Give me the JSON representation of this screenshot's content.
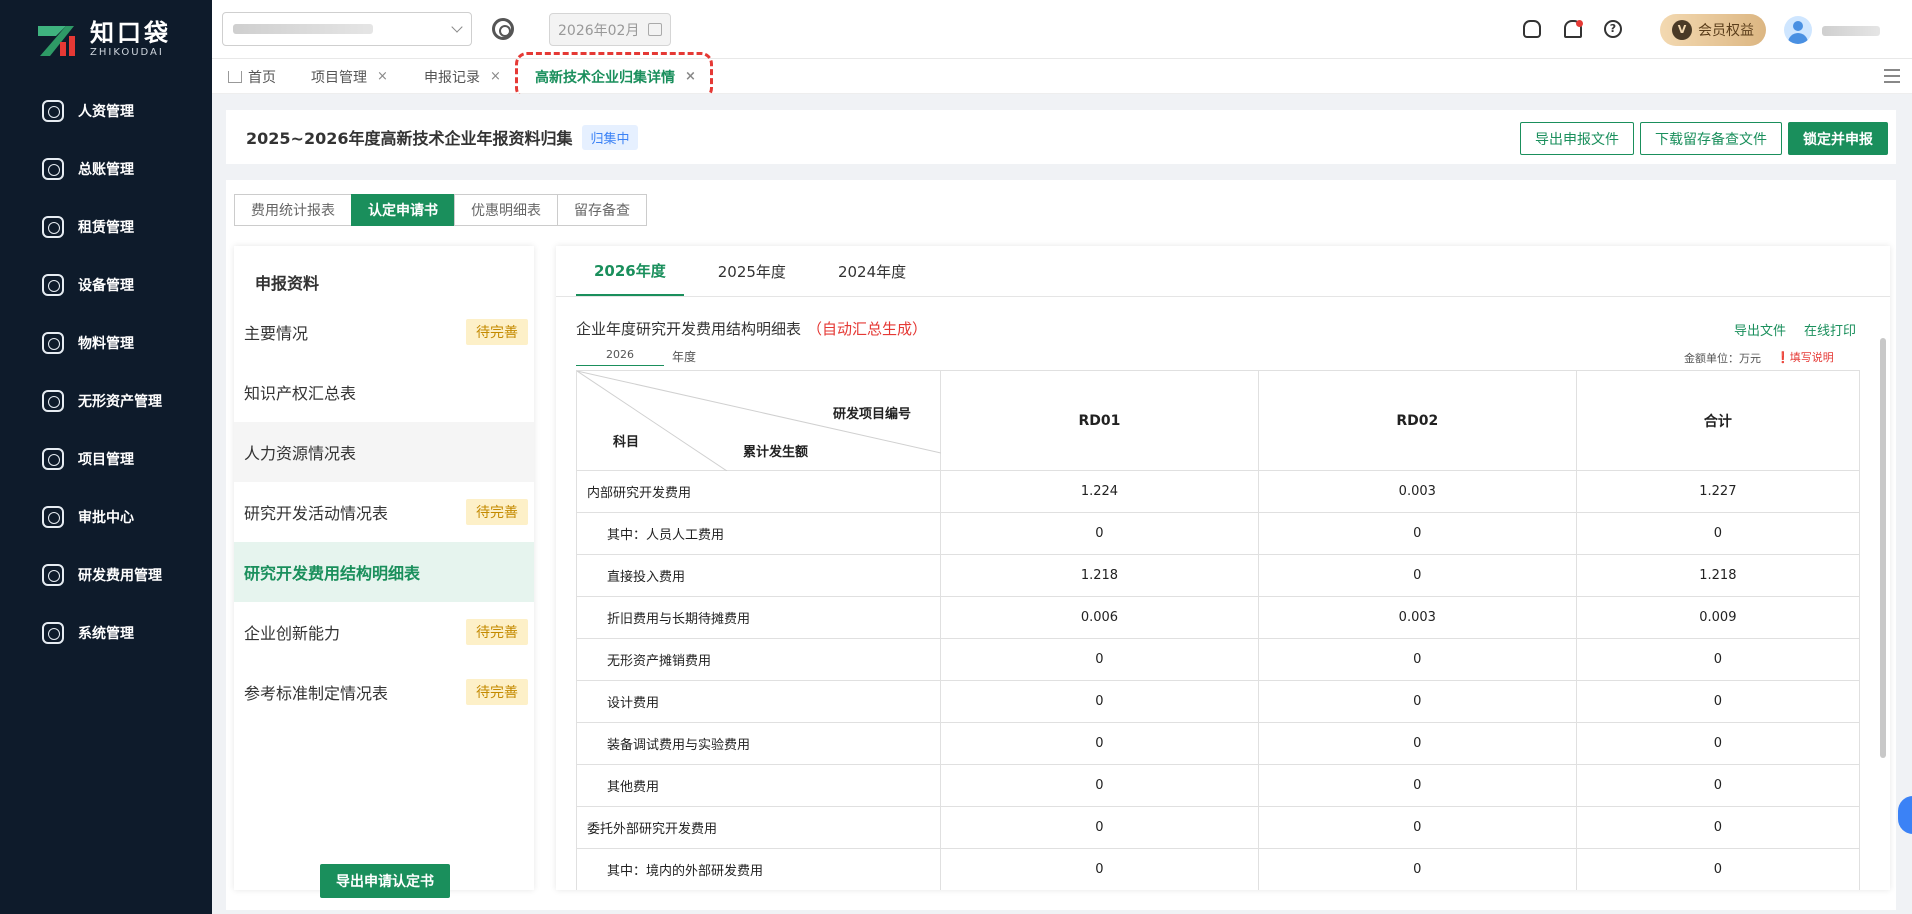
{
  "app": {
    "logo_cn": "知口袋",
    "logo_en": "ZHIKOUDAI"
  },
  "sidebar": {
    "items": [
      {
        "label": "人资管理",
        "icon": "user-circle-icon"
      },
      {
        "label": "总账管理",
        "icon": "ledger-icon"
      },
      {
        "label": "租赁管理",
        "icon": "lease-icon"
      },
      {
        "label": "设备管理",
        "icon": "device-icon"
      },
      {
        "label": "物料管理",
        "icon": "material-icon"
      },
      {
        "label": "无形资产管理",
        "icon": "chart-icon"
      },
      {
        "label": "项目管理",
        "icon": "project-icon"
      },
      {
        "label": "审批中心",
        "icon": "approval-icon"
      },
      {
        "label": "研发费用管理",
        "icon": "rd-expense-icon"
      },
      {
        "label": "系统管理",
        "icon": "settings-icon"
      }
    ]
  },
  "topbar": {
    "month": "2026年02月",
    "vip_badge": "V",
    "vip_label": "会员权益",
    "help_glyph": "?"
  },
  "tabs": [
    {
      "label": "首页"
    },
    {
      "label": "项目管理",
      "close": "×"
    },
    {
      "label": "申报记录",
      "close": "×"
    },
    {
      "label": "高新技术企业归集详情",
      "close": "×"
    }
  ],
  "header": {
    "title": "2025~2026年度高新技术企业年报资料归集",
    "status": "归集中",
    "btn_export": "导出申报文件",
    "btn_download": "下载留存备查文件",
    "btn_lock": "锁定并申报"
  },
  "segments": [
    "费用统计报表",
    "认定申请书",
    "优惠明细表",
    "留存备查"
  ],
  "left_panel": {
    "title": "申报资料",
    "items": [
      {
        "label": "主要情况",
        "badge": "待完善"
      },
      {
        "label": "知识产权汇总表",
        "badge": ""
      },
      {
        "label": "人力资源情况表",
        "badge": ""
      },
      {
        "label": "研究开发活动情况表",
        "badge": "待完善"
      },
      {
        "label": "研究开发费用结构明细表",
        "badge": ""
      },
      {
        "label": "企业创新能力",
        "badge": "待完善"
      },
      {
        "label": "参考标准制定情况表",
        "badge": "待完善"
      }
    ],
    "export_btn": "导出申请认定书"
  },
  "right_panel": {
    "year_tabs": [
      "2026年度",
      "2025年度",
      "2024年度"
    ],
    "table_title": "企业年度研究开发费用结构明细表",
    "auto_note": "（自动汇总生成）",
    "link_export": "导出文件",
    "link_print": "在线打印",
    "year_value": "2026",
    "year_unit": "年度",
    "amount_unit": "金额单位：万元",
    "fill_help": "❗填写说明",
    "diag": {
      "project_no": "研发项目编号",
      "accumulated": "累计发生额",
      "subject": "科目"
    },
    "columns": [
      "RD01",
      "RD02",
      "合计"
    ],
    "rows": [
      {
        "subject": "内部研究开发费用",
        "indent": false,
        "values": [
          "1.224",
          "0.003",
          "1.227"
        ]
      },
      {
        "subject": "其中：人员人工费用",
        "indent": true,
        "values": [
          "0",
          "0",
          "0"
        ]
      },
      {
        "subject": "直接投入费用",
        "indent": true,
        "values": [
          "1.218",
          "0",
          "1.218"
        ]
      },
      {
        "subject": "折旧费用与长期待摊费用",
        "indent": true,
        "values": [
          "0.006",
          "0.003",
          "0.009"
        ]
      },
      {
        "subject": "无形资产摊销费用",
        "indent": true,
        "values": [
          "0",
          "0",
          "0"
        ]
      },
      {
        "subject": "设计费用",
        "indent": true,
        "values": [
          "0",
          "0",
          "0"
        ]
      },
      {
        "subject": "装备调试费用与实验费用",
        "indent": true,
        "values": [
          "0",
          "0",
          "0"
        ]
      },
      {
        "subject": "其他费用",
        "indent": true,
        "values": [
          "0",
          "0",
          "0"
        ]
      },
      {
        "subject": "委托外部研究开发费用",
        "indent": false,
        "values": [
          "0",
          "0",
          "0"
        ]
      },
      {
        "subject": "其中：境内的外部研发费用",
        "indent": true,
        "values": [
          "0",
          "0",
          "0"
        ]
      }
    ]
  }
}
